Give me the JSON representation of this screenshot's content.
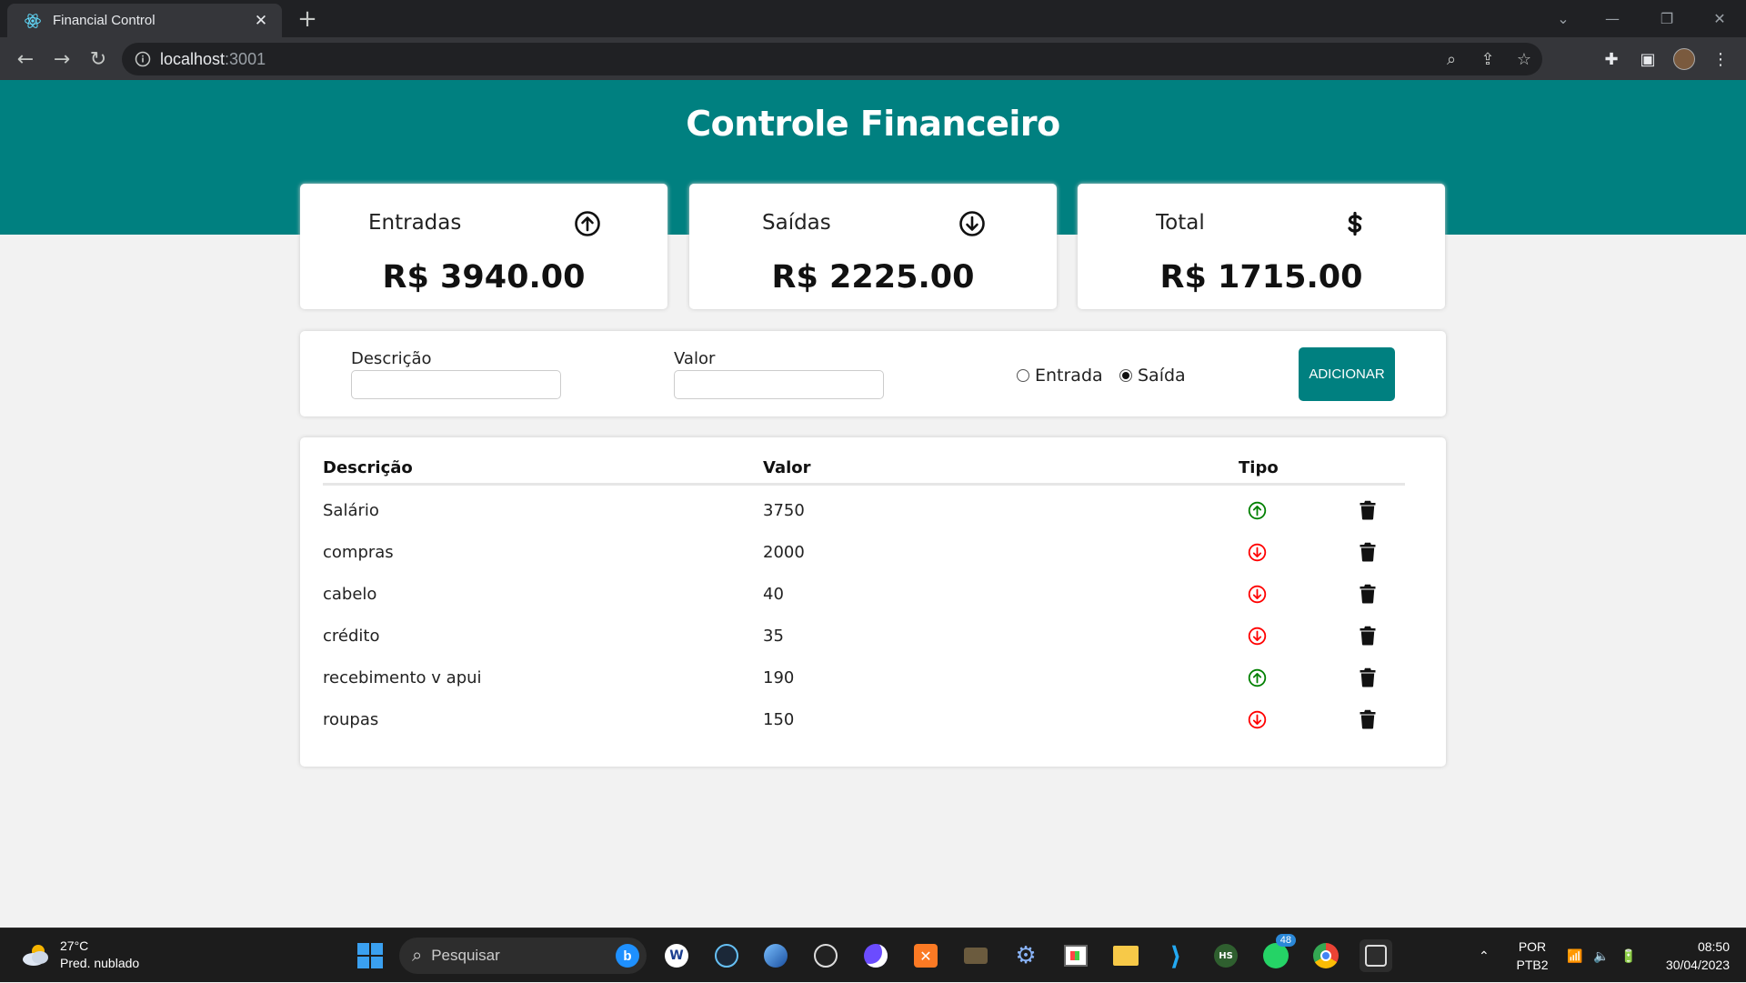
{
  "browser": {
    "tab_title": "Financial Control",
    "url_host": "localhost",
    "url_port": ":3001"
  },
  "app": {
    "title": "Controle Financeiro",
    "cards": [
      {
        "label": "Entradas",
        "value": "R$ 3940.00",
        "icon": "arrow-up-circle-icon"
      },
      {
        "label": "Saídas",
        "value": "R$ 2225.00",
        "icon": "arrow-down-circle-icon"
      },
      {
        "label": "Total",
        "value": "R$ 1715.00",
        "icon": "dollar-icon"
      }
    ],
    "form": {
      "description_label": "Descrição",
      "description_value": "",
      "amount_label": "Valor",
      "amount_value": "",
      "radio_income": "Entrada",
      "radio_expense": "Saída",
      "selected_type": "Saída",
      "add_button": "ADICIONAR"
    },
    "table": {
      "headers": [
        "Descrição",
        "Valor",
        "Tipo"
      ],
      "rows": [
        {
          "description": "Salário",
          "value": "3750",
          "type": "income"
        },
        {
          "description": "compras",
          "value": "2000",
          "type": "expense"
        },
        {
          "description": "cabelo",
          "value": "40",
          "type": "expense"
        },
        {
          "description": "crédito",
          "value": "35",
          "type": "expense"
        },
        {
          "description": "recebimento v apui",
          "value": "190",
          "type": "income"
        },
        {
          "description": "roupas",
          "value": "150",
          "type": "expense"
        }
      ]
    },
    "colors": {
      "primary": "#008080",
      "income": "#008000",
      "expense": "#ff0000",
      "background": "#f2f2f2"
    }
  },
  "taskbar": {
    "weather_temp": "27°C",
    "weather_desc": "Pred. nublado",
    "search_placeholder": "Pesquisar",
    "whatsapp_badge": "48",
    "language": "POR",
    "keyboard": "PTB2",
    "time": "08:50",
    "date": "30/04/2023"
  }
}
